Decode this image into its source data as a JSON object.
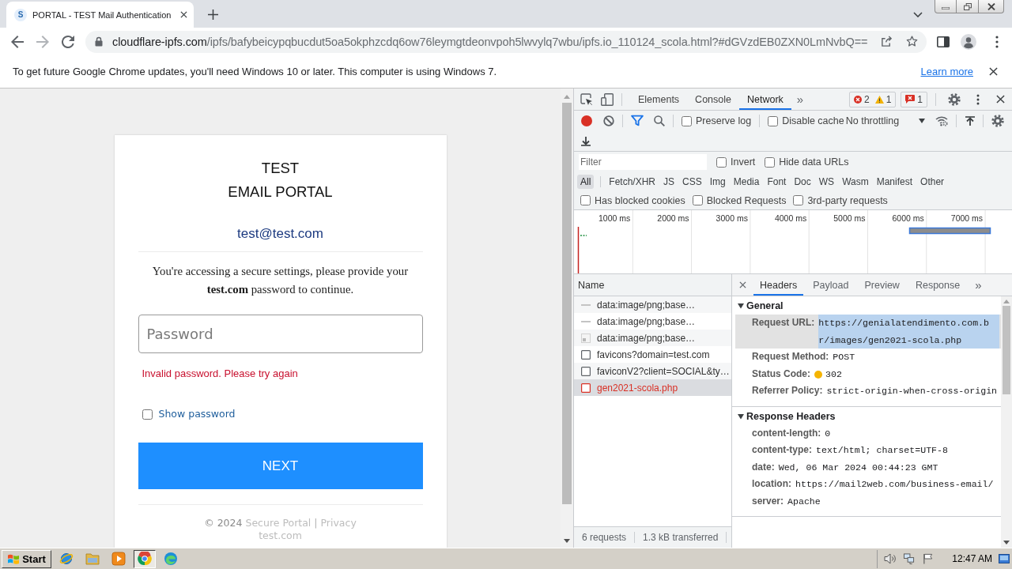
{
  "browser": {
    "tabs": [
      {
        "title": "PORTAL - TEST Mail Authentication",
        "favicon": "S",
        "selected": true
      }
    ],
    "address_bar": {
      "domain": "cloudflare-ipfs.com",
      "path": "/ipfs/bafybeicypqbucdut5oa5okphzcdq6ow76leymgtdeonvpoh5lwvylq7wbu/ipfs.io_110124_scola.html?#dGVzdEB0ZXN0LmNvbQ=="
    },
    "infobar": {
      "message": "To get future Google Chrome updates, you'll need Windows 10 or later. This computer is using Windows 7.",
      "link": "Learn more"
    }
  },
  "page": {
    "title_lines": [
      "TEST",
      "EMAIL PORTAL"
    ],
    "email": "test@test.com",
    "instructions": "You're accessing a secure settings, please provide your **test.com** password to continue.",
    "password_field": {
      "placeholder": "Password"
    },
    "error": "Invalid password. Please try again",
    "show_password": {
      "label": "Show password",
      "checked": false
    },
    "next_button": "NEXT",
    "footer": {
      "copyright": "© 2024",
      "links": [
        "Secure Portal",
        "Privacy"
      ],
      "separator": "|",
      "domain": "test.com"
    }
  },
  "devtools": {
    "tabs": [
      {
        "label": "Elements",
        "selected": false
      },
      {
        "label": "Console",
        "selected": false
      },
      {
        "label": "Network",
        "selected": true
      }
    ],
    "more_tabs": "»",
    "console_counts": {
      "errors": "2",
      "warnings": "1",
      "issues": "1"
    },
    "toolbar": {
      "recording": true,
      "options": [
        {
          "label": "Preserve log",
          "checked": false
        },
        {
          "label": "Disable cache",
          "checked": false
        }
      ],
      "throttling": "No throttling"
    },
    "filter": {
      "placeholder": "Filter",
      "options": [
        {
          "label": "Invert",
          "checked": false
        },
        {
          "label": "Hide data URLs",
          "checked": false
        }
      ]
    },
    "types": [
      {
        "label": "All",
        "selected": true
      },
      {
        "label": "Fetch/XHR",
        "selected": false
      },
      {
        "label": "JS",
        "selected": false
      },
      {
        "label": "CSS",
        "selected": false
      },
      {
        "label": "Img",
        "selected": false
      },
      {
        "label": "Media",
        "selected": false
      },
      {
        "label": "Font",
        "selected": false
      },
      {
        "label": "Doc",
        "selected": false
      },
      {
        "label": "WS",
        "selected": false
      },
      {
        "label": "Wasm",
        "selected": false
      },
      {
        "label": "Manifest",
        "selected": false
      },
      {
        "label": "Other",
        "selected": false
      }
    ],
    "request_filters": [
      {
        "label": "Has blocked cookies",
        "checked": false
      },
      {
        "label": "Blocked Requests",
        "checked": false
      },
      {
        "label": "3rd-party requests",
        "checked": false
      }
    ],
    "timeline": {
      "ticks": [
        "1000 ms",
        "2000 ms",
        "3000 ms",
        "4000 ms",
        "5000 ms",
        "6000 ms",
        "7000 ms"
      ]
    },
    "requests": {
      "column": "Name",
      "rows": [
        {
          "name": "data:image/png;base…",
          "kind": "dash",
          "failed": false,
          "selected": false
        },
        {
          "name": "data:image/png;base…",
          "kind": "dash",
          "failed": false,
          "selected": false
        },
        {
          "name": "data:image/png;base…",
          "kind": "image",
          "failed": false,
          "selected": false
        },
        {
          "name": "favicons?domain=test.com",
          "kind": "document",
          "failed": false,
          "selected": false
        },
        {
          "name": "faviconV2?client=SOCIAL&ty…",
          "kind": "document",
          "failed": false,
          "selected": false
        },
        {
          "name": "gen2021-scola.php",
          "kind": "document",
          "failed": true,
          "selected": true
        }
      ]
    },
    "summary": [
      "6 requests",
      "1.3 kB transferred"
    ],
    "detail_tabs": [
      {
        "label": "Headers",
        "selected": true
      },
      {
        "label": "Payload",
        "selected": false
      },
      {
        "label": "Preview",
        "selected": false
      },
      {
        "label": "Response",
        "selected": false
      }
    ],
    "more_detail_tabs": "»",
    "sections": [
      {
        "title": "General",
        "expanded": true,
        "headers": [
          {
            "key": "Request URL:",
            "value": "https://genialatendimento.com.br/images/gen2021-scola.php",
            "kind": "plain",
            "highlighted": true
          },
          {
            "key": "Request Method:",
            "value": "POST",
            "kind": "plain",
            "highlighted": false
          },
          {
            "key": "Status Code:",
            "value": "302",
            "kind": "status",
            "highlighted": false
          },
          {
            "key": "Referrer Policy:",
            "value": "strict-origin-when-cross-origin",
            "kind": "plain",
            "highlighted": false
          }
        ]
      },
      {
        "title": "Response Headers",
        "expanded": true,
        "headers": [
          {
            "key": "content-length:",
            "value": "0",
            "kind": "plain",
            "highlighted": false
          },
          {
            "key": "content-type:",
            "value": "text/html; charset=UTF-8",
            "kind": "plain",
            "highlighted": false
          },
          {
            "key": "date:",
            "value": "Wed, 06 Mar 2024 00:44:23 GMT",
            "kind": "plain",
            "highlighted": false
          },
          {
            "key": "location:",
            "value": "https://mail2web.com/business-email/",
            "kind": "plain",
            "highlighted": false
          },
          {
            "key": "server:",
            "value": "Apache",
            "kind": "plain",
            "highlighted": false
          }
        ]
      }
    ]
  },
  "taskbar": {
    "start": "Start",
    "apps": [
      {
        "kind": "globe",
        "selected": false
      },
      {
        "kind": "folder",
        "selected": false
      },
      {
        "kind": "player",
        "selected": false
      },
      {
        "kind": "browser",
        "selected": true
      },
      {
        "kind": "swirl",
        "selected": false
      }
    ],
    "clock": "12:47 AM"
  }
}
